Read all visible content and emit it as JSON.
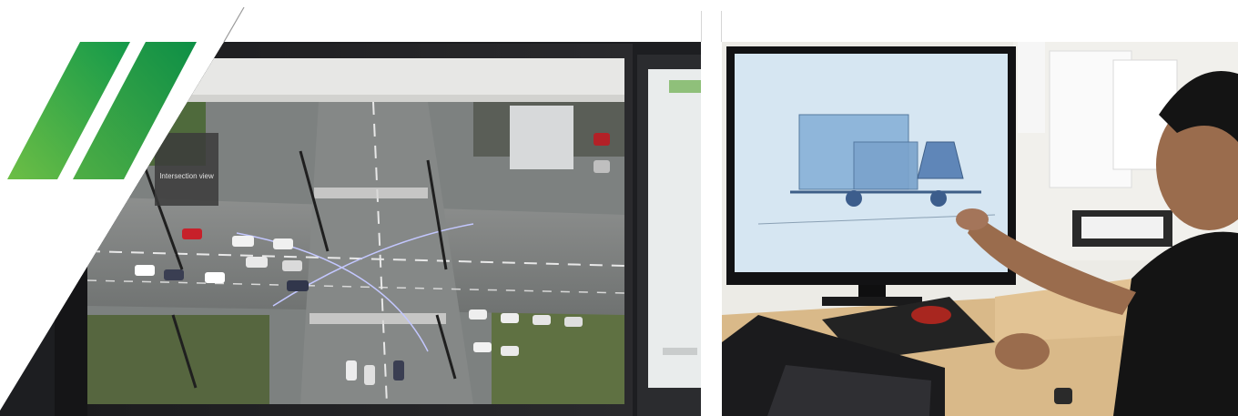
{
  "brand": {
    "stripe_color_light": "#6dbe45",
    "stripe_color_dark": "#13994a",
    "accent_line_color": "#9a9a9a"
  },
  "left_photo": {
    "icon": "monitor-aerial-intersection-photo",
    "map_label": "Intersection view"
  },
  "right_photo": {
    "icon": "engineer-cad-truck-photo"
  }
}
